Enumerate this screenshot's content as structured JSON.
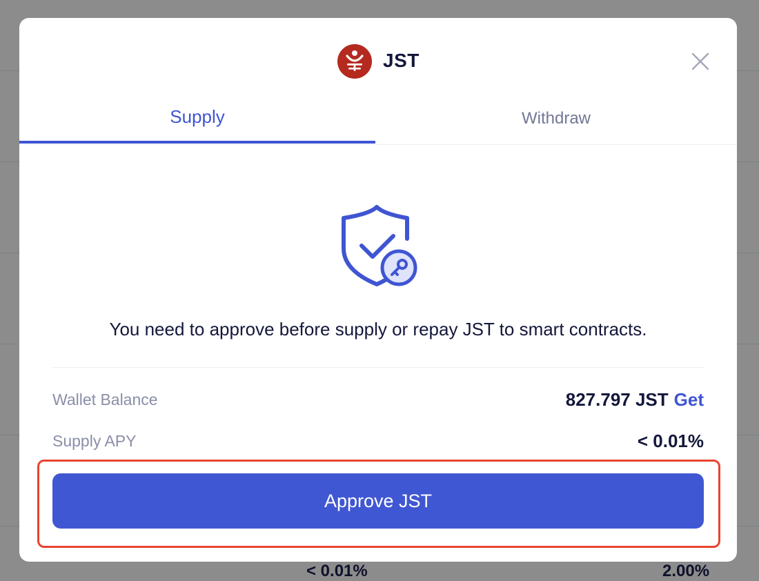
{
  "background": {
    "cells": [
      "< 0.01%",
      "2.00%"
    ]
  },
  "modal": {
    "token": {
      "name": "JST",
      "logo_icon": "jst-token-icon",
      "logo_color": "#b52a1f"
    },
    "close_icon": "close-icon",
    "tabs": [
      {
        "label": "Supply",
        "active": true
      },
      {
        "label": "Withdraw",
        "active": false
      }
    ],
    "illustration_icon": "shield-check-key-icon",
    "notice": "You need to approve before supply or repay JST to smart contracts.",
    "rows": [
      {
        "label": "Wallet Balance",
        "value": "827.797 JST",
        "link": "Get"
      },
      {
        "label": "Supply APY",
        "value": "< 0.01%"
      }
    ],
    "approve_button": "Approve JST"
  },
  "colors": {
    "accent": "#3f55d2",
    "highlight": "#e8432e",
    "text_dark": "#14173b",
    "text_muted": "#8a8ea8"
  }
}
